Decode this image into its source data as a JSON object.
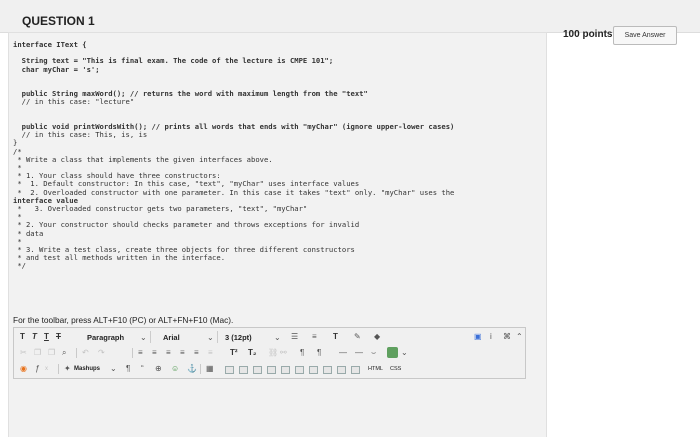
{
  "question": {
    "title": "QUESTION 1",
    "points": "100 points",
    "save_label": "Save Answer"
  },
  "code_lines": [
    "interface IText {",
    "",
    "  String text = \"This is final exam. The code of the lecture is CMPE 101\";",
    "  char myChar = 's';",
    "",
    "",
    "  public String maxWord(); // returns the word with maximum length from the \"text\"",
    "  // in this case: \"lecture\"",
    "",
    "",
    "  public void printWordsWith(); // prints all words that ends with \"myChar\" (ignore upper-lower cases)",
    "  // in this case: This, is, is",
    "}",
    "/*",
    " * Write a class that implements the given interfaces above.",
    " *",
    " * 1. Your class should have three constructors:",
    " *  1. Default constructor: In this case, \"text\", \"myChar\" uses interface values",
    " *  2. Overloaded constructor with one parameter. In this case it takes \"text\" only. \"myChar\" uses the",
    "interface value",
    " *   3. Overloaded constructor gets two parameters, \"text\", \"myChar\"",
    " *",
    " * 2. Your constructor should checks parameter and throws exceptions for invalid",
    " * data",
    " *",
    " * 3. Write a test class, create three objects for three different constructors",
    " * and test all methods written in the interface.",
    " */"
  ],
  "editor": {
    "instruction": "For the toolbar, press ALT+F10 (PC) or ALT+FN+F10 (Mac).",
    "paragraph_label": "Paragraph",
    "font_label": "Arial",
    "size_label": "3 (12pt)",
    "mashups_label": "Mashups",
    "html_label": "HTML",
    "css_label": "CSS",
    "row1_format_glyphs": [
      "T",
      "T",
      "T",
      "T"
    ],
    "row1_list_glyphs": [
      "☰",
      "≡",
      "T"
    ],
    "row1_right_glyphs": [
      "▣",
      "i",
      "⌘",
      "⌃"
    ],
    "row2_glyphs": [
      "✂",
      "❐",
      "❐",
      "⌕"
    ],
    "row2_align_glyphs": [
      "≡",
      "≡",
      "≡",
      "≡",
      "≡",
      "≡"
    ],
    "row2_super": "T²",
    "row2_sub": "T₂",
    "row3_glyphs": [
      "¶",
      "“",
      "⊕",
      "☺",
      "⚓",
      "▦"
    ]
  }
}
